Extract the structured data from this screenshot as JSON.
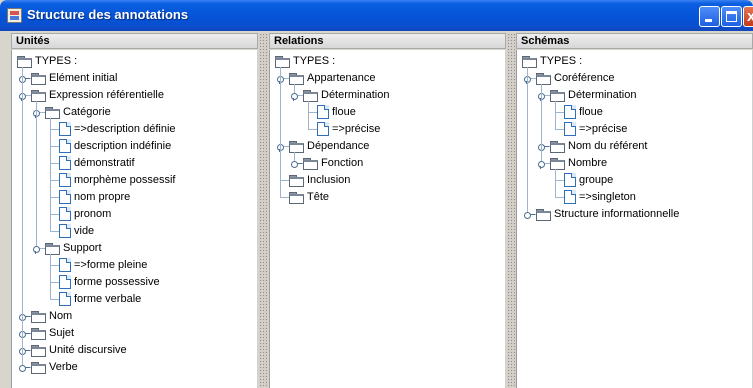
{
  "window": {
    "title": "Structure des annotations",
    "controls": {
      "minimize": "",
      "maximize": "",
      "close": "x"
    }
  },
  "panels": [
    {
      "id": "unites",
      "header": "Unités",
      "root": "TYPES :",
      "nodes": [
        {
          "label": "Elément initial",
          "depth": 1,
          "kind": "folder",
          "state": "collapsed"
        },
        {
          "label": "Expression référentielle",
          "depth": 1,
          "kind": "folder",
          "state": "expanded"
        },
        {
          "label": "Catégorie",
          "depth": 2,
          "kind": "folder",
          "state": "expanded"
        },
        {
          "label": "=>description définie",
          "depth": 3,
          "kind": "leaf"
        },
        {
          "label": "description indéfinie",
          "depth": 3,
          "kind": "leaf"
        },
        {
          "label": "démonstratif",
          "depth": 3,
          "kind": "leaf"
        },
        {
          "label": "morphème possessif",
          "depth": 3,
          "kind": "leaf"
        },
        {
          "label": "nom propre",
          "depth": 3,
          "kind": "leaf"
        },
        {
          "label": "pronom",
          "depth": 3,
          "kind": "leaf"
        },
        {
          "label": "vide",
          "depth": 3,
          "kind": "leaf"
        },
        {
          "label": "Support",
          "depth": 2,
          "kind": "folder",
          "state": "expanded"
        },
        {
          "label": "=>forme pleine",
          "depth": 3,
          "kind": "leaf"
        },
        {
          "label": "forme possessive",
          "depth": 3,
          "kind": "leaf"
        },
        {
          "label": "forme verbale",
          "depth": 3,
          "kind": "leaf"
        },
        {
          "label": "Nom",
          "depth": 1,
          "kind": "folder",
          "state": "collapsed"
        },
        {
          "label": "Sujet",
          "depth": 1,
          "kind": "folder",
          "state": "collapsed"
        },
        {
          "label": "Unité discursive",
          "depth": 1,
          "kind": "folder",
          "state": "collapsed"
        },
        {
          "label": "Verbe",
          "depth": 1,
          "kind": "folder",
          "state": "collapsed"
        }
      ]
    },
    {
      "id": "relations",
      "header": "Relations",
      "root": "TYPES :",
      "nodes": [
        {
          "label": "Appartenance",
          "depth": 1,
          "kind": "folder",
          "state": "expanded"
        },
        {
          "label": "Détermination",
          "depth": 2,
          "kind": "folder",
          "state": "expanded"
        },
        {
          "label": "floue",
          "depth": 3,
          "kind": "leaf"
        },
        {
          "label": "=>précise",
          "depth": 3,
          "kind": "leaf"
        },
        {
          "label": "Dépendance",
          "depth": 1,
          "kind": "folder",
          "state": "expanded"
        },
        {
          "label": "Fonction",
          "depth": 2,
          "kind": "folder",
          "state": "collapsed"
        },
        {
          "label": "Inclusion",
          "depth": 1,
          "kind": "folder",
          "state": "none"
        },
        {
          "label": "Tête",
          "depth": 1,
          "kind": "folder",
          "state": "none"
        }
      ]
    },
    {
      "id": "schemas",
      "header": "Schémas",
      "root": "TYPES :",
      "nodes": [
        {
          "label": "Coréférence",
          "depth": 1,
          "kind": "folder",
          "state": "expanded"
        },
        {
          "label": "Détermination",
          "depth": 2,
          "kind": "folder",
          "state": "expanded"
        },
        {
          "label": "floue",
          "depth": 3,
          "kind": "leaf"
        },
        {
          "label": "=>précise",
          "depth": 3,
          "kind": "leaf"
        },
        {
          "label": "Nom du référent",
          "depth": 2,
          "kind": "folder",
          "state": "collapsed"
        },
        {
          "label": "Nombre",
          "depth": 2,
          "kind": "folder",
          "state": "expanded"
        },
        {
          "label": "groupe",
          "depth": 3,
          "kind": "leaf"
        },
        {
          "label": "=>singleton",
          "depth": 3,
          "kind": "leaf"
        },
        {
          "label": "Structure informationnelle",
          "depth": 1,
          "kind": "folder",
          "state": "collapsed"
        }
      ]
    }
  ]
}
